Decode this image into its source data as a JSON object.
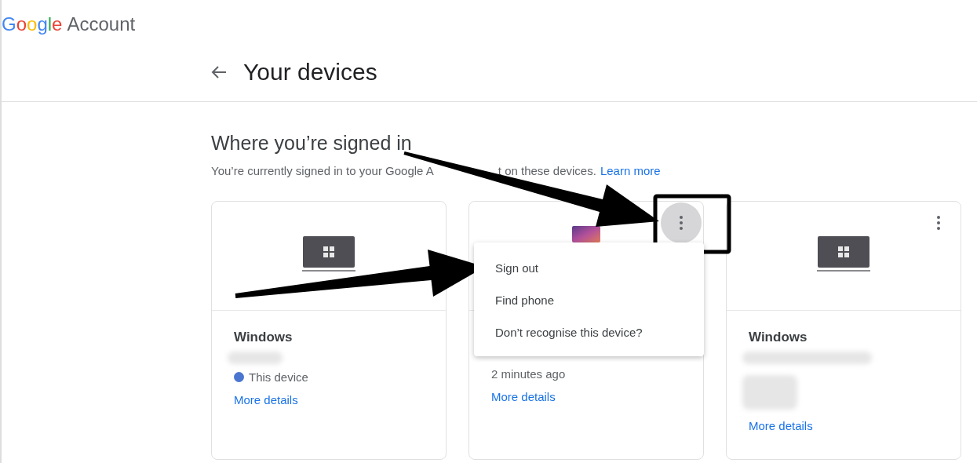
{
  "header": {
    "logo": "Google",
    "product": "Account"
  },
  "page": {
    "title": "Your devices"
  },
  "section": {
    "heading": "Where you’re signed in",
    "description_start": "You’re currently signed in to your Google A",
    "description_end": "t on these devices.",
    "link": "Learn more"
  },
  "devices": [
    {
      "kind": "laptop",
      "name": "Windows",
      "redacted_line": true,
      "redacted_icon": false,
      "this_device": true,
      "status": "This device",
      "menu_button": false,
      "menu_open": false,
      "link": "More details"
    },
    {
      "kind": "phone",
      "redacted_line": false,
      "redacted_icon": false,
      "this_device": false,
      "status": "2 minutes ago",
      "menu_button": true,
      "menu_open": true,
      "link": "More details"
    },
    {
      "kind": "laptop",
      "name": "Windows",
      "redacted_line": true,
      "redacted_icon": true,
      "this_device": false,
      "menu_button": true,
      "menu_open": false,
      "link": "More details"
    }
  ],
  "menu": {
    "items": [
      "Sign out",
      "Find phone",
      "Don’t recognise this device?"
    ]
  }
}
